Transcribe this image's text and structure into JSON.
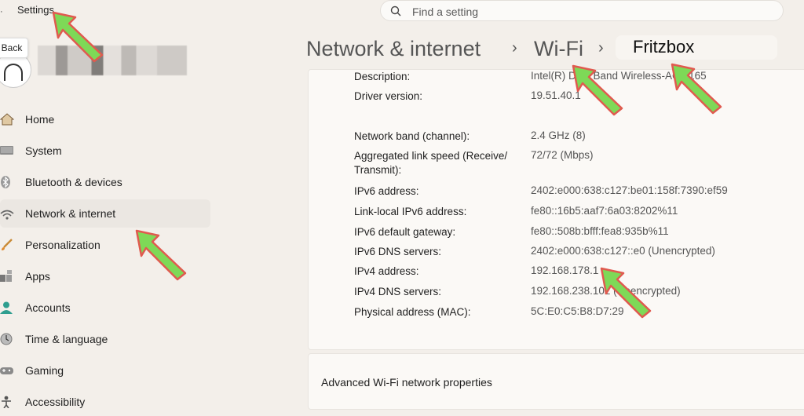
{
  "window": {
    "title": "Settings"
  },
  "back_tooltip": "Back",
  "search": {
    "placeholder": "Find a setting"
  },
  "breadcrumb": {
    "section": "Network & internet",
    "page": "Wi-Fi",
    "network": "Fritzbox"
  },
  "sidebar": {
    "items": [
      {
        "label": "Home",
        "icon": "home-icon",
        "active": false
      },
      {
        "label": "System",
        "icon": "system-icon",
        "active": false
      },
      {
        "label": "Bluetooth & devices",
        "icon": "bluetooth-icon",
        "active": false
      },
      {
        "label": "Network & internet",
        "icon": "wifi-icon",
        "active": true
      },
      {
        "label": "Personalization",
        "icon": "brush-icon",
        "active": false
      },
      {
        "label": "Apps",
        "icon": "apps-icon",
        "active": false
      },
      {
        "label": "Accounts",
        "icon": "person-icon",
        "active": false
      },
      {
        "label": "Time & language",
        "icon": "clock-icon",
        "active": false
      },
      {
        "label": "Gaming",
        "icon": "gamepad-icon",
        "active": false
      },
      {
        "label": "Accessibility",
        "icon": "accessibility-icon",
        "active": false
      }
    ]
  },
  "properties": [
    {
      "key": "Description:",
      "value": "Intel(R) Dual Band Wireless-AC 3165"
    },
    {
      "key": "Driver version:",
      "value": "19.51.40.1"
    },
    {
      "key": "Network band (channel):",
      "value": "2.4 GHz (8)"
    },
    {
      "key": "Aggregated link speed (Receive/ Transmit):",
      "value": "72/72 (Mbps)"
    },
    {
      "key": "IPv6 address:",
      "value": "2402:e000:638:c127:be01:158f:7390:ef59"
    },
    {
      "key": "Link-local IPv6 address:",
      "value": "fe80::16b5:aaf7:6a03:8202%11"
    },
    {
      "key": "IPv6 default gateway:",
      "value": "fe80::508b:bfff:fea8:935b%11"
    },
    {
      "key": "IPv6 DNS servers:",
      "value": "2402:e000:638:c127::e0 (Unencrypted)"
    },
    {
      "key": "IPv4 address:",
      "value": "192.168.178.1"
    },
    {
      "key": "IPv4 DNS servers:",
      "value": "192.168.238.102 (Unencrypted)"
    },
    {
      "key": "Physical address (MAC):",
      "value": "5C:E0:C5:B8:D7:29"
    }
  ],
  "advanced_label": "Advanced Wi-Fi network properties",
  "colors": {
    "arrow_fill": "#7ed957",
    "arrow_stroke": "#e05a4f",
    "active_bg": "#ebe7e2"
  }
}
